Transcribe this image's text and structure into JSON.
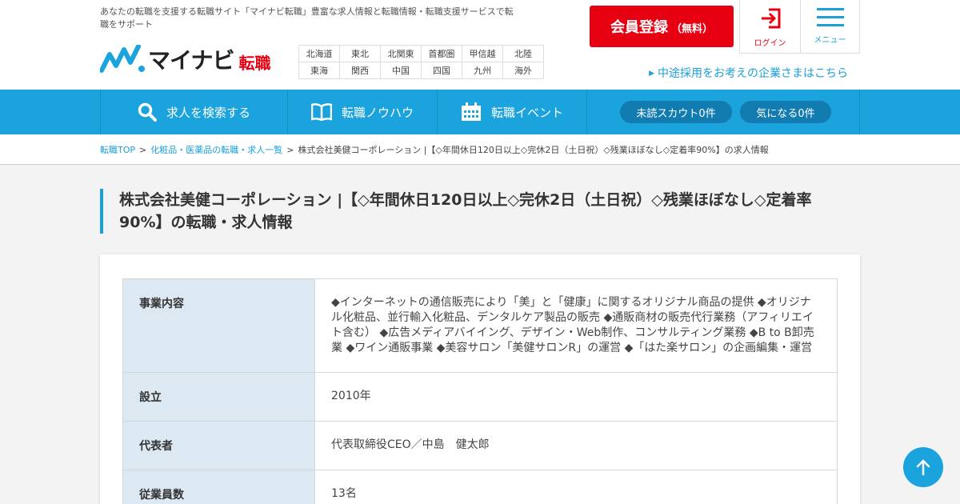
{
  "header": {
    "tagline": "あなたの転職を支援する転職サイト「マイナビ転職」豊富な求人情報と転職情報・転職支援サービスで転職をサポート",
    "logo_main": "マイナビ",
    "logo_sub": "転職",
    "regions": [
      [
        "北海道",
        "東北",
        "北関東",
        "首都圏",
        "甲信越",
        "北陸"
      ],
      [
        "東海",
        "関西",
        "中国",
        "四国",
        "九州",
        "海外"
      ]
    ],
    "register_main": "会員登録",
    "register_sub": "（無料）",
    "login_label": "ログイン",
    "menu_label": "メニュー",
    "corp_link": "中途採用をお考えの企業さまはこちら",
    "brand_color": "#1ba3dd",
    "accent_color": "#e60012"
  },
  "nav": {
    "search": "求人を検索する",
    "knowhow": "転職ノウハウ",
    "event": "転職イベント",
    "scout": "未読スカウト0件",
    "favorite": "気になる0件",
    "icons": [
      "search-icon",
      "book-icon",
      "calendar-icon"
    ]
  },
  "breadcrumb": {
    "home": "転職TOP",
    "category": "化粧品・医薬品の転職・求人一覧",
    "current": "株式会社美健コーポレーション |【◇年間休日120日以上◇完休2日（土日祝）◇残業ほぼなし◇定着率90%】の求人情報",
    "separator": ">"
  },
  "page_title": "株式会社美健コーポレーション |【◇年間休日120日以上◇完休2日（土日祝）◇残業ほぼなし◇定着率90%】の転職・求人情報",
  "company_info": [
    {
      "label": "事業内容",
      "value": "◆インターネットの通信販売により「美」と「健康」に関するオリジナル商品の提供 ◆オリジナル化粧品、並行輸入化粧品、デンタルケア製品の販売 ◆通販商材の販売代行業務（アフィリエイト含む） ◆広告メディアバイイング、デザイン・Web制作、コンサルティング業務 ◆B to B卸売業 ◆ワイン通販事業 ◆美容サロン「美健サロンR」の運営 ◆「はた楽サロン」の企画編集・運営"
    },
    {
      "label": "設立",
      "value": "2010年"
    },
    {
      "label": "代表者",
      "value": "代表取締役CEO／中島　健太郎"
    },
    {
      "label": "従業員数",
      "value": "13名"
    }
  ]
}
